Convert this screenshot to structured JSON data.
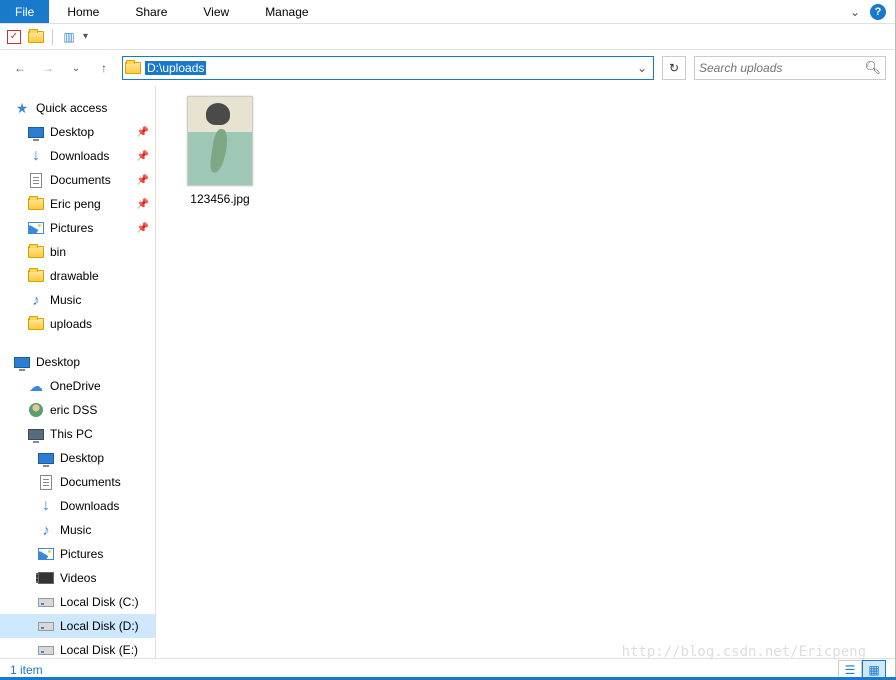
{
  "ribbon": {
    "file": "File",
    "tabs": [
      "Home",
      "Share",
      "View",
      "Manage"
    ]
  },
  "address": {
    "path": "D:\\uploads"
  },
  "search": {
    "placeholder": "Search uploads"
  },
  "nav_pane": {
    "quick_access": {
      "label": "Quick access",
      "items": [
        {
          "label": "Desktop",
          "icon": "monitor",
          "pinned": true
        },
        {
          "label": "Downloads",
          "icon": "arrow-down",
          "pinned": true
        },
        {
          "label": "Documents",
          "icon": "doc",
          "pinned": true
        },
        {
          "label": "Eric peng",
          "icon": "folder",
          "pinned": true
        },
        {
          "label": "Pictures",
          "icon": "pic",
          "pinned": true
        },
        {
          "label": "bin",
          "icon": "folder",
          "pinned": false
        },
        {
          "label": "drawable",
          "icon": "folder",
          "pinned": false
        },
        {
          "label": "Music",
          "icon": "music",
          "pinned": false
        },
        {
          "label": "uploads",
          "icon": "folder",
          "pinned": false
        }
      ]
    },
    "desktop": {
      "label": "Desktop",
      "items": [
        {
          "label": "OneDrive",
          "icon": "cloud"
        },
        {
          "label": "eric DSS",
          "icon": "user"
        },
        {
          "label": "This PC",
          "icon": "monitor-grey",
          "children": [
            {
              "label": "Desktop",
              "icon": "monitor"
            },
            {
              "label": "Documents",
              "icon": "doc"
            },
            {
              "label": "Downloads",
              "icon": "arrow-down"
            },
            {
              "label": "Music",
              "icon": "music"
            },
            {
              "label": "Pictures",
              "icon": "pic"
            },
            {
              "label": "Videos",
              "icon": "video"
            },
            {
              "label": "Local Disk (C:)",
              "icon": "drive"
            },
            {
              "label": "Local Disk (D:)",
              "icon": "drive",
              "selected": true
            },
            {
              "label": "Local Disk (E:)",
              "icon": "drive"
            }
          ]
        }
      ]
    }
  },
  "content": {
    "files": [
      {
        "name": "123456.jpg"
      }
    ]
  },
  "status": {
    "text": "1 item"
  },
  "watermark": "http://blog.csdn.net/Ericpeng"
}
